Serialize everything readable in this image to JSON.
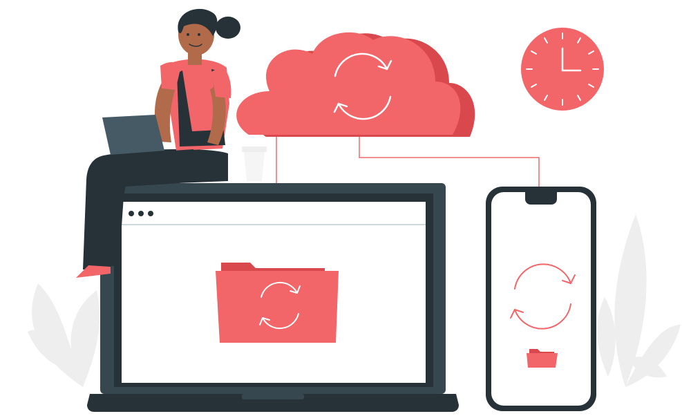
{
  "scene": {
    "subject": "cloud-sync-illustration",
    "colors": {
      "accent": "#F2666A",
      "accent_shadow": "#D9484D",
      "dark": "#263238",
      "frame": "#37474F",
      "light_gray": "#EEEEEE",
      "leaf": "#EBEBEB",
      "skin": "#B16A4A",
      "hair": "#263238",
      "white": "#FFFFFF"
    },
    "icons": [
      "cloud-icon",
      "sync-icon",
      "clock-icon",
      "laptop-icon",
      "smartphone-icon",
      "folder-icon",
      "coffee-cup-icon",
      "person-icon",
      "leaf-icon"
    ],
    "clock": {
      "hour": 12,
      "minute": 15
    }
  }
}
